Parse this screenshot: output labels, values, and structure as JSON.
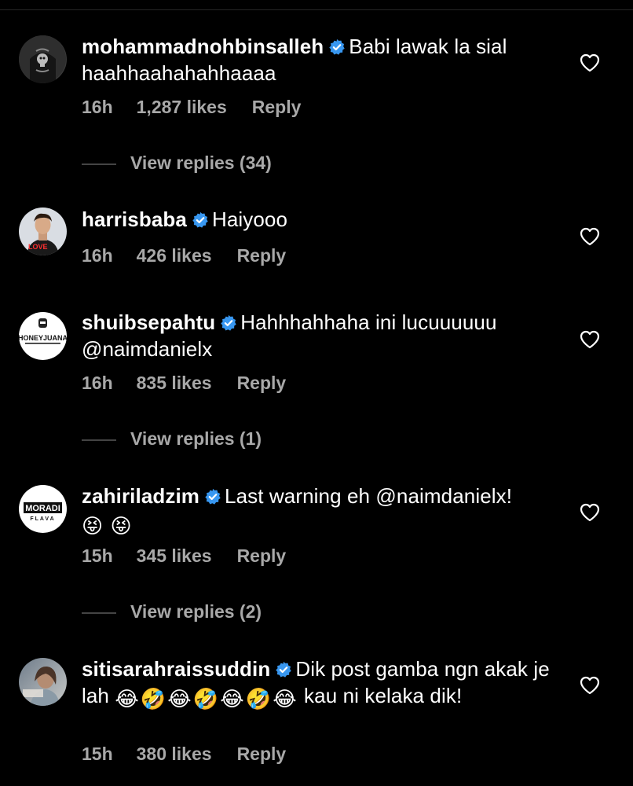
{
  "comments": [
    {
      "username": "mohammadnohbinsalleh",
      "text": "Babi lawak la sial haahhaahahahhaaaa",
      "time": "16h",
      "likes": "1,287 likes",
      "reply": "Reply",
      "view_replies": "View replies (34)"
    },
    {
      "username": "harrisbaba",
      "text": "Haiyooo",
      "time": "16h",
      "likes": "426 likes",
      "reply": "Reply"
    },
    {
      "username": "shuibsepahtu",
      "text": "Hahhhahhaha ini lucuuuuuu @naimdanielx",
      "time": "16h",
      "likes": "835 likes",
      "reply": "Reply",
      "view_replies": "View replies (1)"
    },
    {
      "username": "zahiriladzim",
      "text": "Last warning eh @naimdanielx!",
      "emojis": [
        "😝",
        "😝"
      ],
      "time": "15h",
      "likes": "345 likes",
      "reply": "Reply",
      "view_replies": "View replies (2)"
    },
    {
      "username": "sitisarahraissuddin",
      "text_part1": "Dik post gamba ngn akak je lah",
      "emojis": [
        "😂",
        "🤣",
        "😂",
        "🤣",
        "😂",
        "🤣",
        "😂"
      ],
      "text_part2": "kau ni kelaka dik!",
      "time": "15h",
      "likes": "380 likes",
      "reply": "Reply"
    }
  ],
  "avatar_logos": {
    "shuibsepahtu": "HONEYJUANA",
    "zahiriladzim": "MORADI",
    "zahiriladzim_sub": "FLAVA",
    "harrisbaba": "LOVE"
  },
  "colors": {
    "background": "#000000",
    "text": "#ffffff",
    "secondary": "#a8a8a8",
    "verified": "#3897f0"
  }
}
